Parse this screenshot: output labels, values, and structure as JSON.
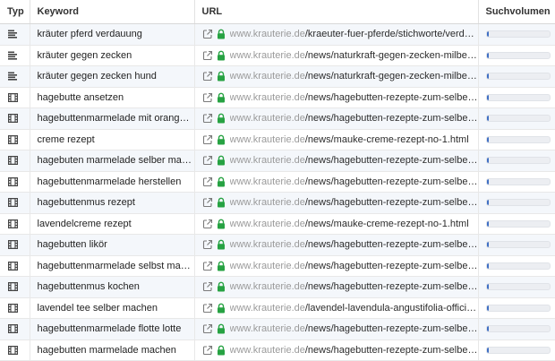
{
  "table": {
    "columns": {
      "type": "Typ",
      "keyword": "Keyword",
      "url": "URL",
      "volume": "Suchvolumen"
    },
    "rows": [
      {
        "type_icon": "text-lines-icon",
        "keyword": "kräuter pferd verdauung",
        "domain": "www.krauterie.de",
        "path": "/kraeuter-fuer-pferde/stichworte/verdauung...",
        "volume_fraction": 0.04
      },
      {
        "type_icon": "text-lines-icon",
        "keyword": "kräuter gegen zecken",
        "domain": "www.krauterie.de",
        "path": "/news/naturkraft-gegen-zecken-milben-floe...",
        "volume_fraction": 0.04
      },
      {
        "type_icon": "text-lines-icon",
        "keyword": "kräuter gegen zecken hund",
        "domain": "www.krauterie.de",
        "path": "/news/naturkraft-gegen-zecken-milben-floe...",
        "volume_fraction": 0.04
      },
      {
        "type_icon": "film-icon",
        "keyword": "hagebutte ansetzen",
        "domain": "www.krauterie.de",
        "path": "/news/hagebutten-rezepte-zum-selbermac...",
        "volume_fraction": 0.04
      },
      {
        "type_icon": "film-icon",
        "keyword": "hagebuttenmarmelade mit orangen...",
        "domain": "www.krauterie.de",
        "path": "/news/hagebutten-rezepte-zum-selbermac...",
        "volume_fraction": 0.04
      },
      {
        "type_icon": "film-icon",
        "keyword": "creme rezept",
        "domain": "www.krauterie.de",
        "path": "/news/mauke-creme-rezept-no-1.html",
        "volume_fraction": 0.04
      },
      {
        "type_icon": "film-icon",
        "keyword": "hagebuten marmelade selber mach...",
        "domain": "www.krauterie.de",
        "path": "/news/hagebutten-rezepte-zum-selbermac...",
        "volume_fraction": 0.04
      },
      {
        "type_icon": "film-icon",
        "keyword": "hagebuttenmarmelade herstellen",
        "domain": "www.krauterie.de",
        "path": "/news/hagebutten-rezepte-zum-selbermac...",
        "volume_fraction": 0.04
      },
      {
        "type_icon": "film-icon",
        "keyword": "hagebuttenmus rezept",
        "domain": "www.krauterie.de",
        "path": "/news/hagebutten-rezepte-zum-selbermac...",
        "volume_fraction": 0.04
      },
      {
        "type_icon": "film-icon",
        "keyword": "lavendelcreme rezept",
        "domain": "www.krauterie.de",
        "path": "/news/mauke-creme-rezept-no-1.html",
        "volume_fraction": 0.04
      },
      {
        "type_icon": "film-icon",
        "keyword": "hagebutten likör",
        "domain": "www.krauterie.de",
        "path": "/news/hagebutten-rezepte-zum-selbermac...",
        "volume_fraction": 0.04
      },
      {
        "type_icon": "film-icon",
        "keyword": "hagebuttenmarmelade selbst mach...",
        "domain": "www.krauterie.de",
        "path": "/news/hagebutten-rezepte-zum-selbermac...",
        "volume_fraction": 0.04
      },
      {
        "type_icon": "film-icon",
        "keyword": "hagebuttenmus kochen",
        "domain": "www.krauterie.de",
        "path": "/news/hagebutten-rezepte-zum-selbermac...",
        "volume_fraction": 0.04
      },
      {
        "type_icon": "film-icon",
        "keyword": "lavendel tee selber machen",
        "domain": "www.krauterie.de",
        "path": "/lavendel-lavendula-angustifolia-officinalis...",
        "volume_fraction": 0.04
      },
      {
        "type_icon": "film-icon",
        "keyword": "hagebuttenmarmelade flotte lotte",
        "domain": "www.krauterie.de",
        "path": "/news/hagebutten-rezepte-zum-selbermac...",
        "volume_fraction": 0.04
      },
      {
        "type_icon": "film-icon",
        "keyword": "hagebutten marmelade machen",
        "domain": "www.krauterie.de",
        "path": "/news/hagebutten-rezepte-zum-selbermac...",
        "volume_fraction": 0.04
      }
    ]
  },
  "icons": {
    "external": "external-link-icon",
    "lock": "lock-icon"
  },
  "colors": {
    "lock": "#27a243",
    "bar_fill": "#3f6fc4",
    "row_alt": "#f4f7fb"
  }
}
